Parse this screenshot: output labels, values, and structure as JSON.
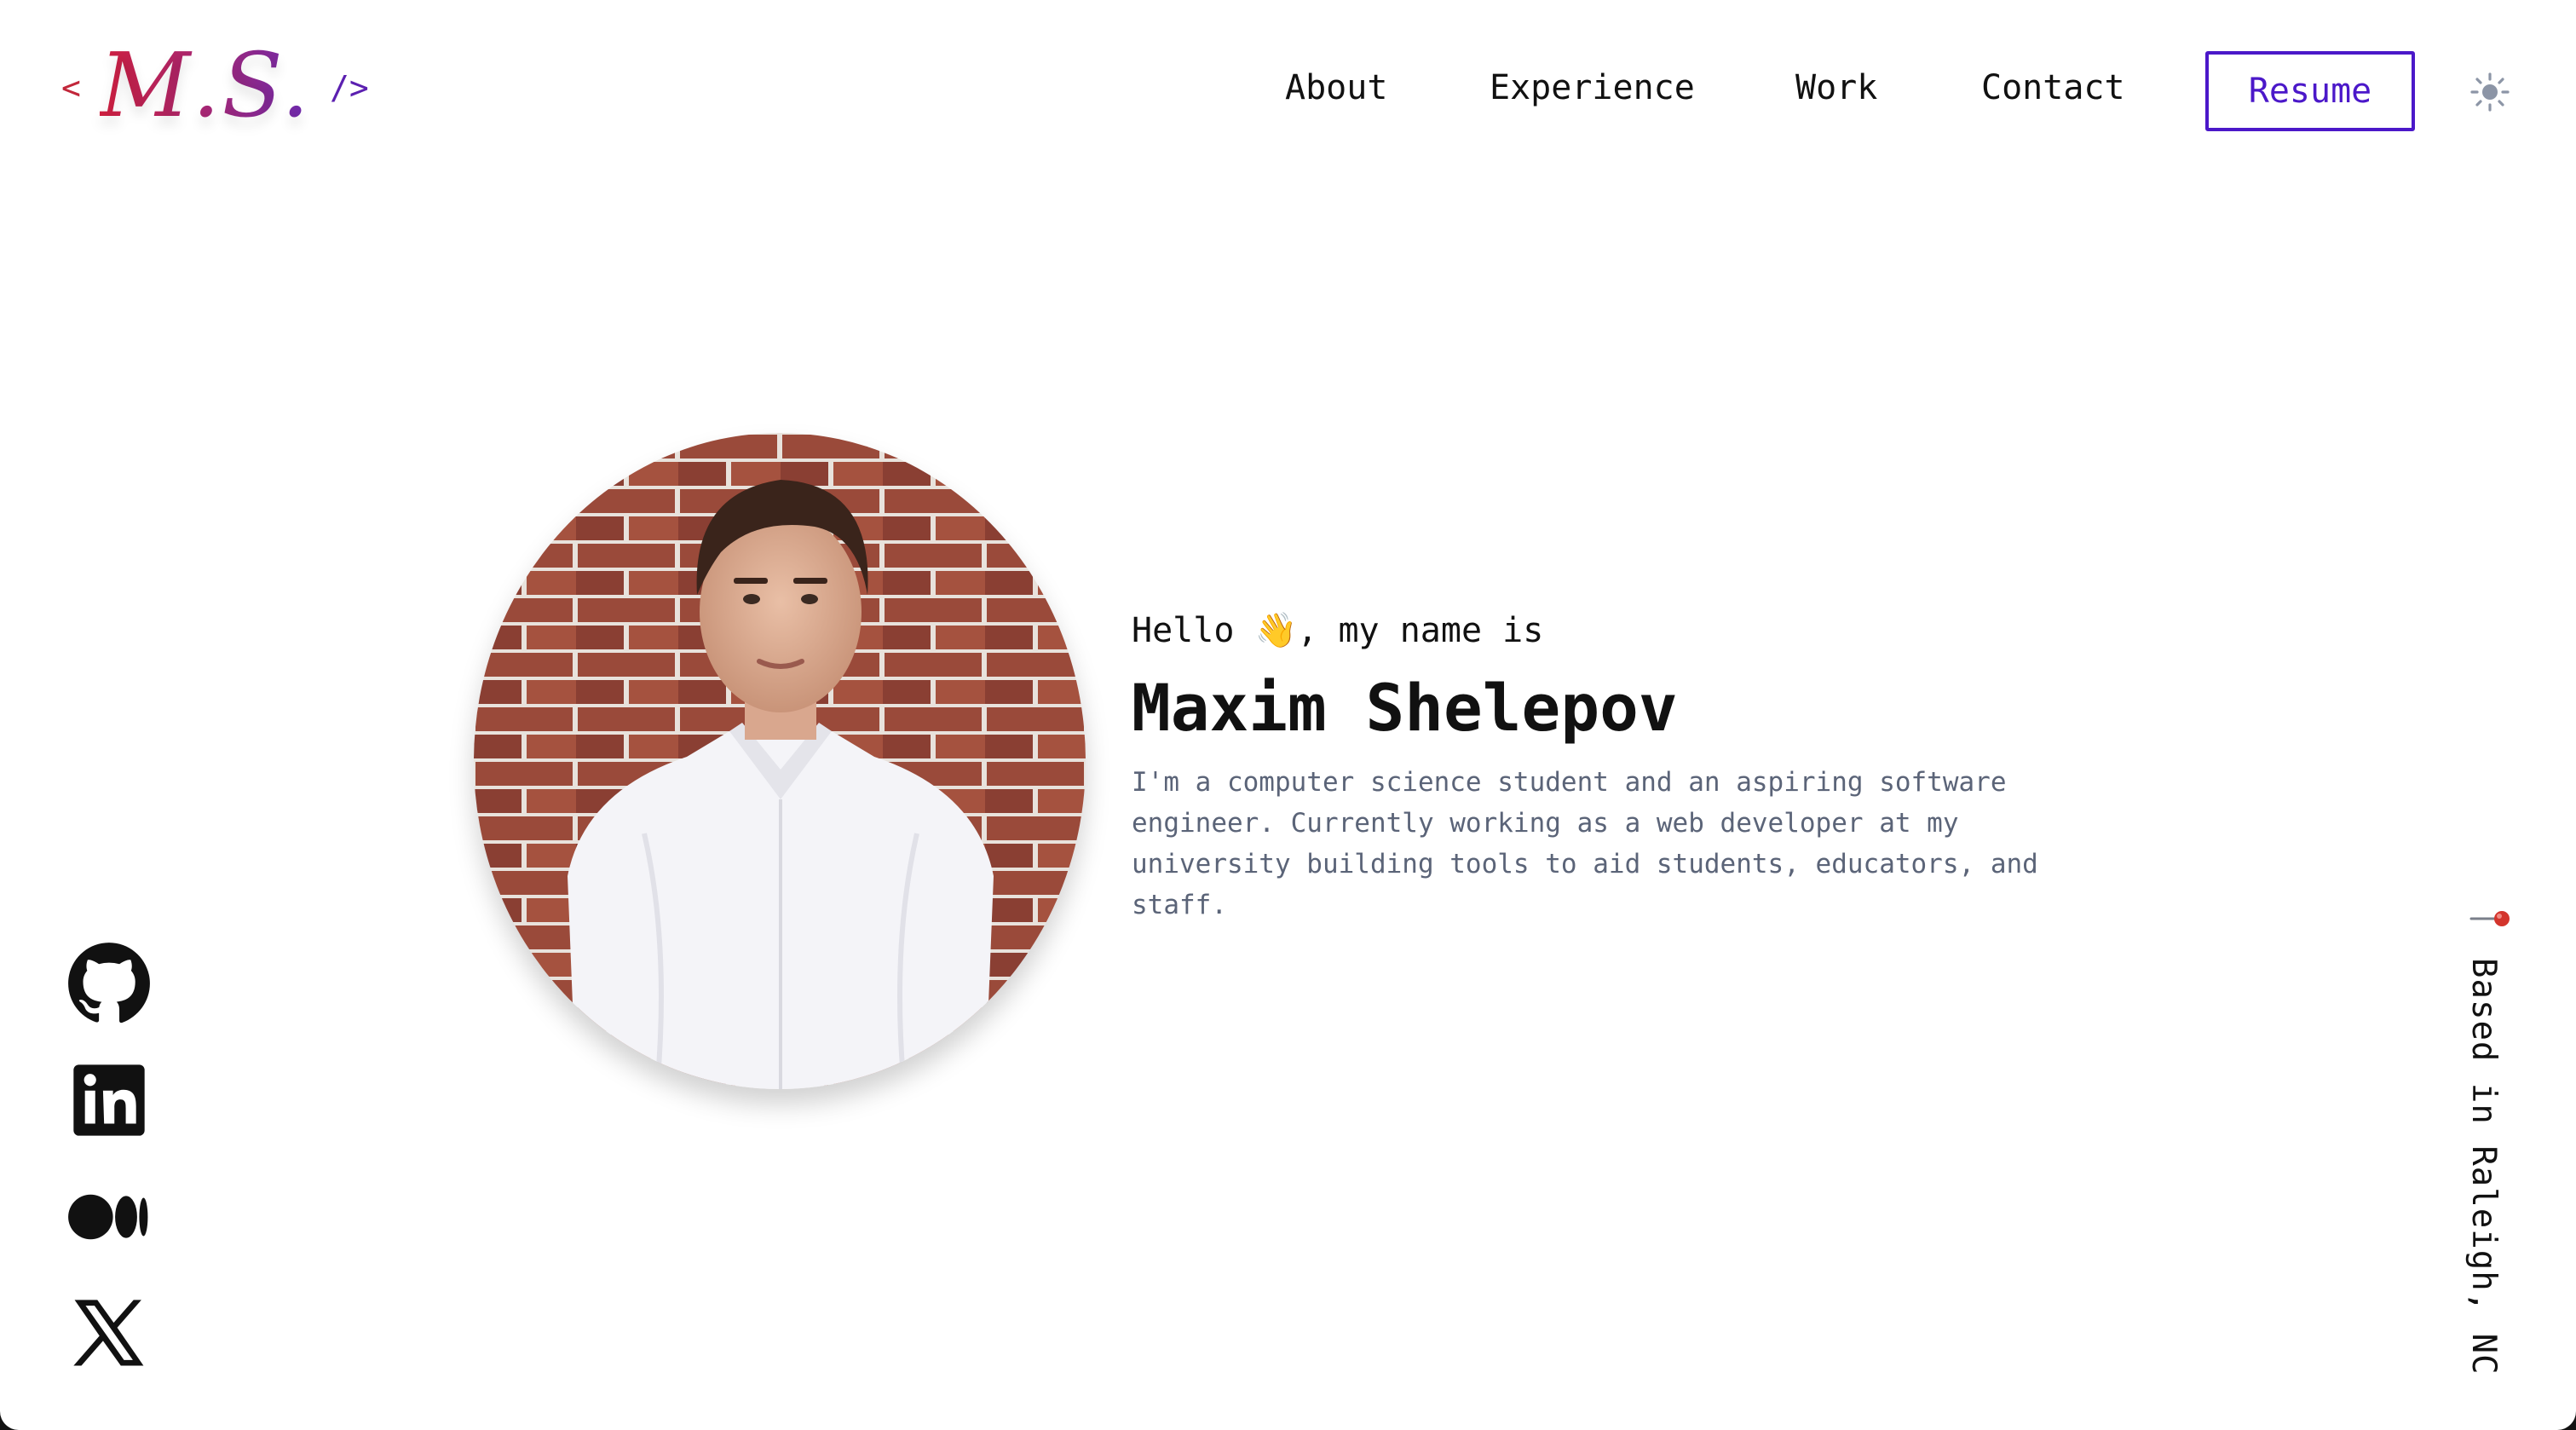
{
  "logo": {
    "open": "<",
    "text": "M.S.",
    "close": "/>"
  },
  "nav": {
    "links": [
      "About",
      "Experience",
      "Work",
      "Contact"
    ],
    "resume_label": "Resume",
    "theme_icon": "sun-icon"
  },
  "hero": {
    "greeting": "Hello 👋, my name is",
    "name": "Maxim Shelepov",
    "bio": "I'm a computer science student and an aspiring software engineer. Currently working as a web developer at my university building tools to aid students, educators, and staff."
  },
  "socials": [
    {
      "icon": "github-icon"
    },
    {
      "icon": "linkedin-icon"
    },
    {
      "icon": "medium-icon"
    },
    {
      "icon": "x-icon"
    }
  ],
  "location": {
    "icon": "pushpin-icon",
    "text": "Based in Raleigh, NC"
  },
  "colors": {
    "accent": "#4b18c9",
    "logo_red": "#d11f3f",
    "logo_purple": "#6b2ab0",
    "bio_text": "#5b6478"
  }
}
